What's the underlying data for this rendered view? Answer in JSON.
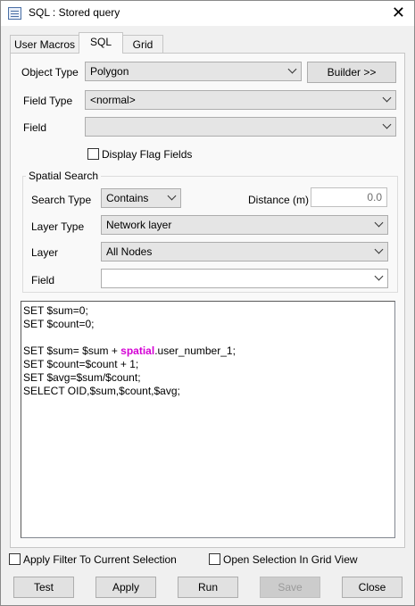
{
  "window": {
    "title": "SQL : Stored query"
  },
  "tabs": [
    {
      "label": "User Macros"
    },
    {
      "label": "SQL"
    },
    {
      "label": "Grid"
    }
  ],
  "form": {
    "object_type_label": "Object Type",
    "object_type_value": "Polygon",
    "builder_button": "Builder >>",
    "field_type_label": "Field Type",
    "field_type_value": "<normal>",
    "field_label": "Field",
    "field_value": "",
    "display_flag_fields": "Display Flag Fields"
  },
  "spatial": {
    "group_title": "Spatial Search",
    "search_type_label": "Search Type",
    "search_type_value": "Contains",
    "distance_label": "Distance (m)",
    "distance_value": "0.0",
    "layer_type_label": "Layer Type",
    "layer_type_value": "Network layer",
    "layer_label": "Layer",
    "layer_value": "All Nodes",
    "field_label": "Field",
    "field_value": ""
  },
  "sql": {
    "line1": "SET $sum=0;",
    "line2": "SET $count=0;",
    "line3_pre": "SET $sum= $sum + ",
    "line3_kw": "spatial",
    "line3_post": ".user_number_1;",
    "line4": "SET $count=$count + 1;",
    "line5": "SET $avg=$sum/$count;",
    "line6": "SELECT OID,$sum,$count,$avg;"
  },
  "options": {
    "apply_filter": "Apply Filter To Current Selection",
    "open_grid": "Open Selection In Grid View"
  },
  "buttons": {
    "test": "Test",
    "apply": "Apply",
    "run": "Run",
    "save": "Save",
    "close": "Close"
  }
}
